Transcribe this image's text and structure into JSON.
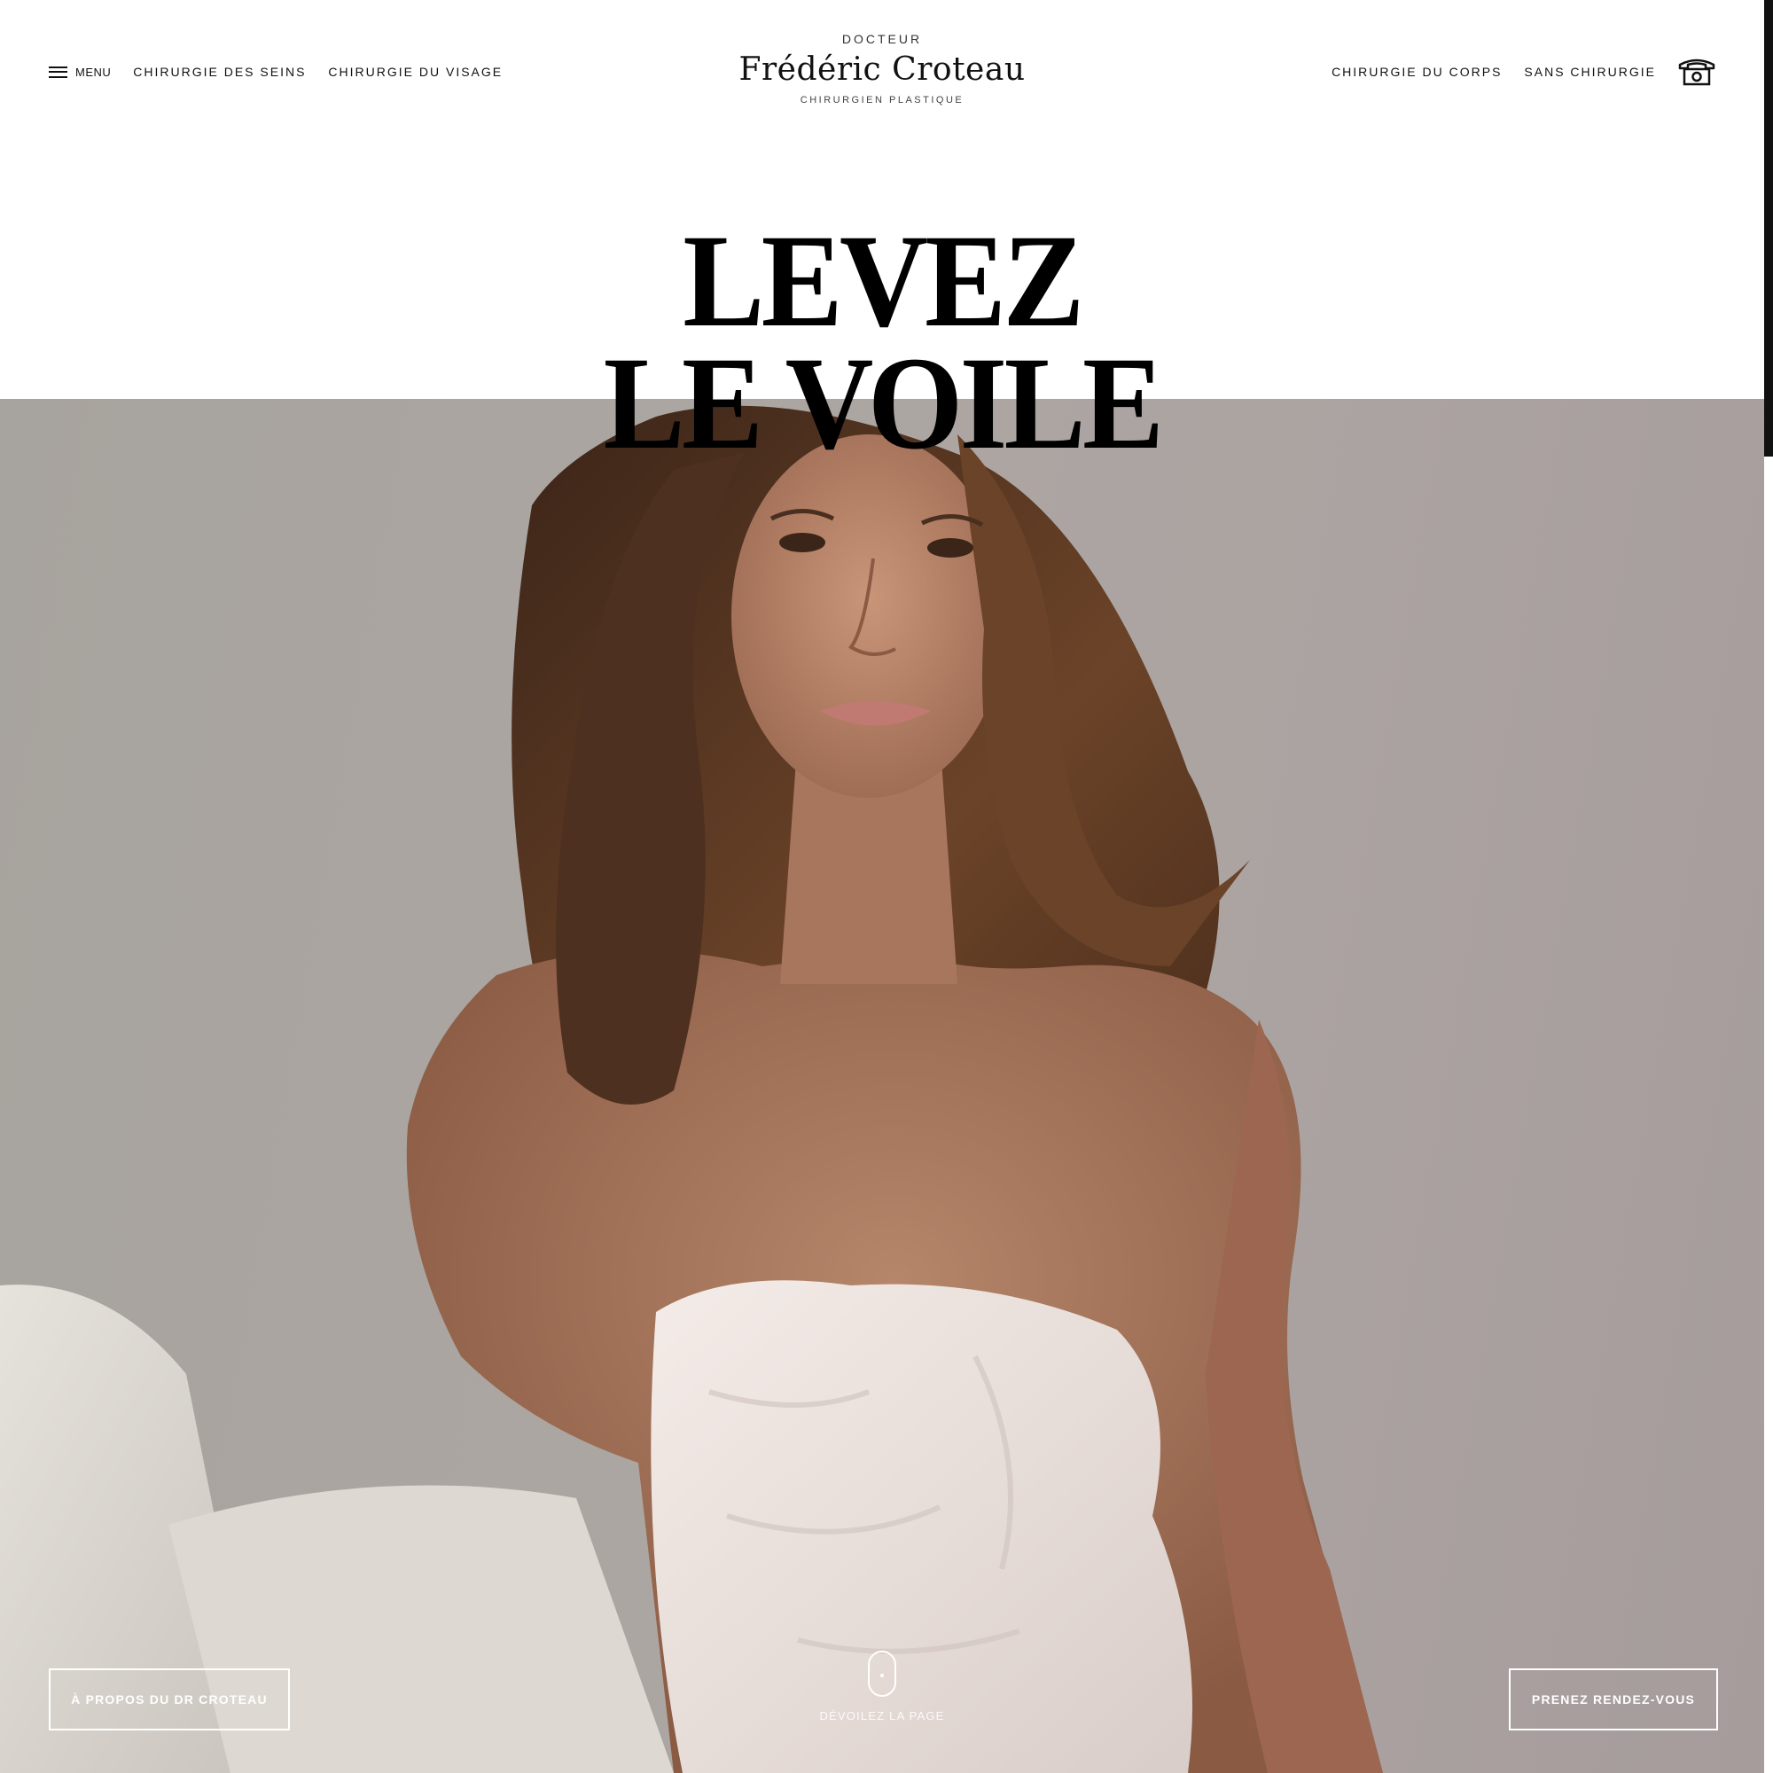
{
  "header": {
    "menu_label": "Menu",
    "nav_left": [
      "CHIRURGIE DES SEINS",
      "CHIRURGIE DU VISAGE"
    ],
    "nav_right": [
      "CHIRURGIE DU CORPS",
      "SANS CHIRURGIE"
    ],
    "logo": {
      "top": "DOCTEUR",
      "name": "Frédéric Croteau",
      "subtitle": "CHIRURGIEN PLASTIQUE"
    },
    "phone_icon": "telephone-icon"
  },
  "hero": {
    "headline_line1": "LEVEZ",
    "headline_line2": "LE VOILE",
    "about_button": "À PROPOS DU DR CROTEAU",
    "appointment_button": "PRENEZ RENDEZ-VOUS",
    "scroll_label": "DÉVOILEZ LA PAGE",
    "image": "Photo of a woman with long brown hair wrapped in a white sheet, seated on a bed with white pillows"
  },
  "colors": {
    "text": "#111111",
    "background": "#ffffff",
    "hero_bg": "#a9a29f",
    "button_border": "#ffffff"
  }
}
